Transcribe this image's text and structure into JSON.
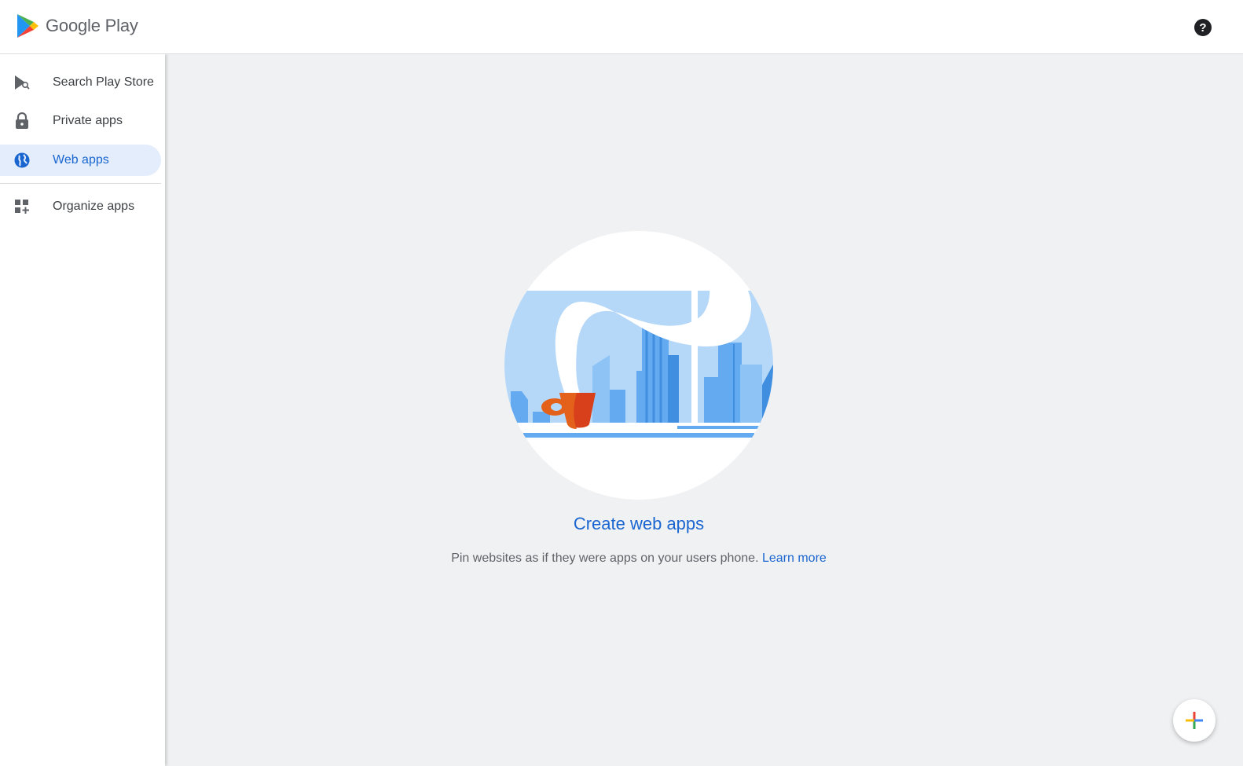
{
  "header": {
    "logo_text": "Google Play",
    "help_icon": "help-icon",
    "help_glyph": "?"
  },
  "sidebar": {
    "items": [
      {
        "label": "Search Play Store",
        "icon": "play-search-icon",
        "active": false
      },
      {
        "label": "Private apps",
        "icon": "lock-icon",
        "active": false
      },
      {
        "label": "Web apps",
        "icon": "globe-icon",
        "active": true
      },
      {
        "label": "Organize apps",
        "icon": "grid-add-icon",
        "active": false
      }
    ]
  },
  "main": {
    "illustration": "city-skyline-coffee-illustration",
    "title": "Create web apps",
    "description": "Pin websites as if they were apps on your users phone.",
    "learn_more": "Learn more"
  },
  "fab": {
    "icon": "plus-icon"
  },
  "colors": {
    "accent": "#1a66d0",
    "active_bg": "#e3edfb",
    "background": "#f0f1f3",
    "text": "#3c4043"
  }
}
